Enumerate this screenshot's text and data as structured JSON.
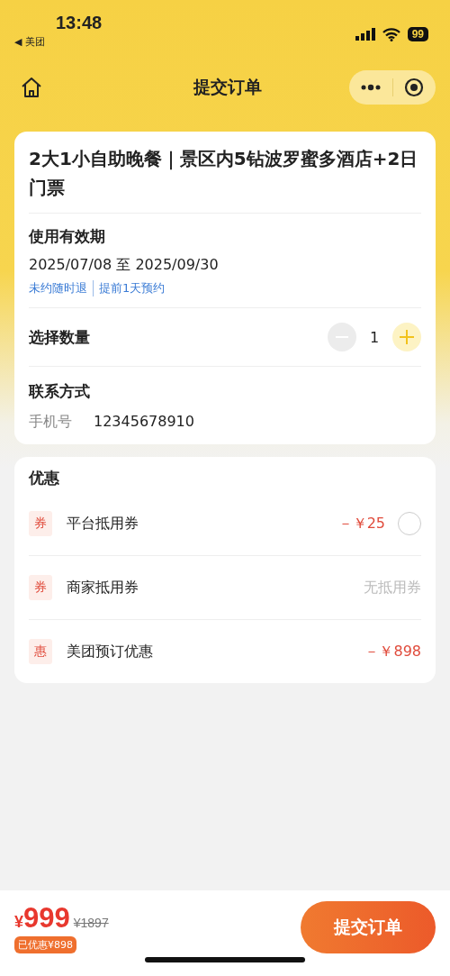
{
  "status_bar": {
    "time": "13:48",
    "back_app": "◀ 美团",
    "battery": "99"
  },
  "nav": {
    "title": "提交订单"
  },
  "order": {
    "title": "2大1小自助晚餐｜景区内5钻波罗蜜多酒店+2日门票",
    "validity": {
      "label": "使用有效期",
      "dates": "2025/07/08 至 2025/09/30",
      "tags": [
        "未约随时退",
        "提前1天预约"
      ]
    },
    "quantity": {
      "label": "选择数量",
      "value": "1",
      "minus_disabled": true
    },
    "contact": {
      "label": "联系方式",
      "field_label": "手机号",
      "phone": "12345678910"
    }
  },
  "discounts": {
    "title": "优惠",
    "items": [
      {
        "badge": "券",
        "name": "平台抵用券",
        "kind": "amount",
        "value": "－￥25",
        "checked": false
      },
      {
        "badge": "券",
        "name": "商家抵用券",
        "kind": "note",
        "value": "无抵用券"
      },
      {
        "badge": "惠",
        "name": "美团预订优惠",
        "kind": "amount",
        "value": "－￥898"
      }
    ]
  },
  "footer": {
    "currency": "¥",
    "price": "999",
    "original_price": "¥1897",
    "saved": "已优惠¥898",
    "submit": "提交订单"
  }
}
